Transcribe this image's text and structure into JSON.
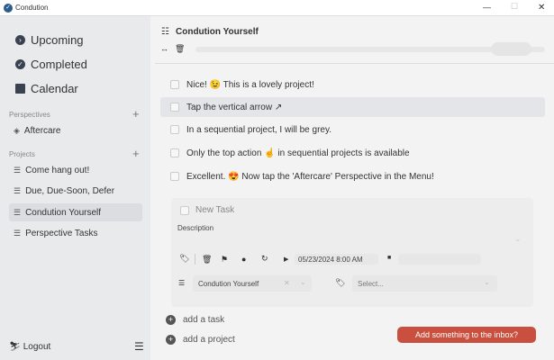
{
  "window": {
    "title": "Condution",
    "minimize": "—",
    "maximize": "☐",
    "close": "✕"
  },
  "sidebar": {
    "nav": [
      {
        "label": "Upcoming",
        "icon": "chevron-right-circle-icon"
      },
      {
        "label": "Completed",
        "icon": "check-circle-icon"
      },
      {
        "label": "Calendar",
        "icon": "calendar-icon"
      }
    ],
    "perspectives_label": "Perspectives",
    "perspectives": [
      {
        "label": "Aftercare",
        "icon": "layers-icon"
      }
    ],
    "projects_label": "Projects",
    "projects": [
      {
        "label": "Come hang out!"
      },
      {
        "label": "Due, Due-Soon, Defer"
      },
      {
        "label": "Condution Yourself",
        "selected": true
      },
      {
        "label": "Perspective Tasks"
      }
    ],
    "logout": "Logout"
  },
  "header": {
    "title": "Condution Yourself"
  },
  "tasks": [
    {
      "text": "Nice! 😉 This is a lovely project!"
    },
    {
      "text": "Tap the vertical arrow ↗",
      "highlighted": true
    },
    {
      "text": "In a sequential project, I will be grey."
    },
    {
      "text": "Only the top action ☝️  in sequential projects is available"
    },
    {
      "text": "Excellent. 😍 Now tap the 'Aftercare' Perspective in the Menu!"
    }
  ],
  "new_task": {
    "placeholder": "New Task",
    "description_placeholder": "Description",
    "defer_date": "05/23/2024 8:00 AM",
    "due_date": "",
    "project": "Condution Yourself",
    "tags_placeholder": "Select..."
  },
  "actions": {
    "add_task": "add a task",
    "add_project": "add a project",
    "inbox_button": "Add something to the inbox?"
  },
  "colors": {
    "accent": "#c9503e",
    "sidebar": "#e9eaec",
    "main": "#f3f3f3"
  }
}
